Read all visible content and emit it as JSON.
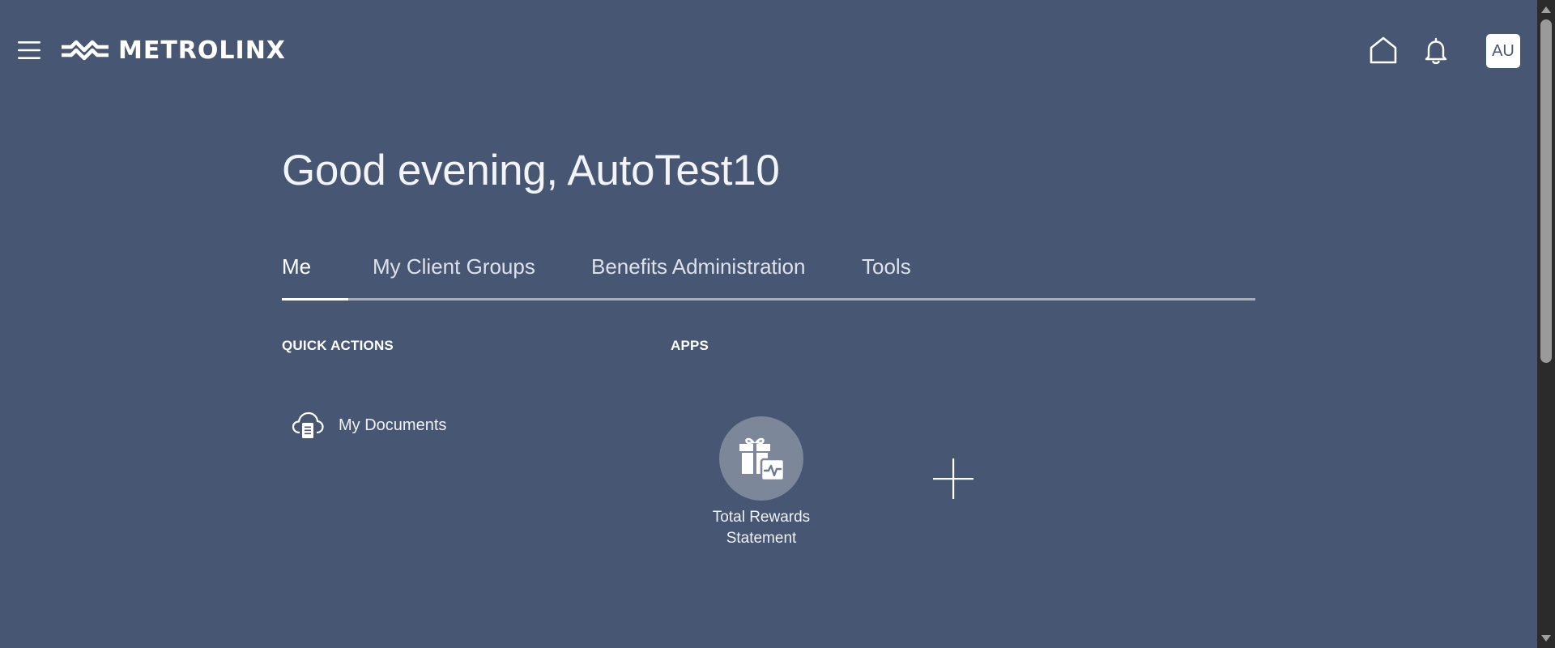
{
  "header": {
    "brand_name": "METROLINX",
    "user_initials": "AU"
  },
  "greeting": "Good evening, AutoTest10",
  "tabs": [
    {
      "label": "Me",
      "active": true
    },
    {
      "label": "My Client Groups",
      "active": false
    },
    {
      "label": "Benefits Administration",
      "active": false
    },
    {
      "label": "Tools",
      "active": false
    }
  ],
  "quick_actions": {
    "title": "QUICK ACTIONS",
    "items": [
      {
        "label": "My Documents",
        "icon": "cloud-document-icon"
      }
    ]
  },
  "apps": {
    "title": "APPS",
    "items": [
      {
        "label_line1": "Total Rewards",
        "label_line2": "Statement",
        "icon": "gift-activity-icon"
      }
    ],
    "add_icon": "plus-icon"
  },
  "colors": {
    "background": "#475672",
    "tab_underline": "#a7aebb",
    "app_circle": "#7c879a",
    "scrollbar": "#2b2b2b"
  }
}
